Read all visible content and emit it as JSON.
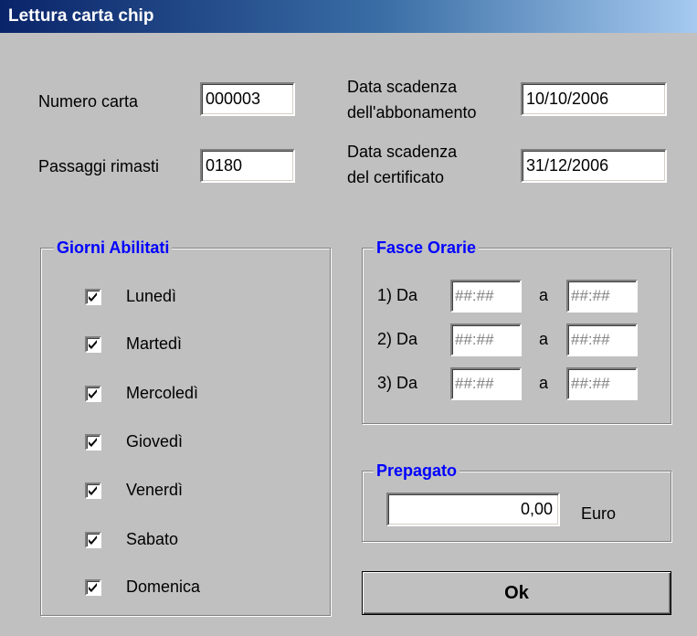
{
  "window": {
    "title": "Lettura carta chip"
  },
  "fields": {
    "numero_carta": {
      "label": "Numero carta",
      "value": "000003"
    },
    "passaggi_rimasti": {
      "label": "Passaggi rimasti",
      "value": "0180"
    },
    "scadenza_abbonamento": {
      "label_line1": "Data scadenza",
      "label_line2": "dell'abbonamento",
      "value": "10/10/2006"
    },
    "scadenza_certificato": {
      "label_line1": "Data scadenza",
      "label_line2": "del certificato",
      "value": "31/12/2006"
    }
  },
  "giorni": {
    "title": "Giorni Abilitati",
    "days": [
      {
        "label": "Lunedì",
        "checked": true
      },
      {
        "label": "Martedì",
        "checked": true
      },
      {
        "label": "Mercoledì",
        "checked": true
      },
      {
        "label": "Giovedì",
        "checked": true
      },
      {
        "label": "Venerdì",
        "checked": true
      },
      {
        "label": "Sabato",
        "checked": true
      },
      {
        "label": "Domenica",
        "checked": true
      }
    ]
  },
  "fasce": {
    "title": "Fasce Orarie",
    "rows": [
      {
        "label": "1) Da",
        "sep": "a",
        "from": "##:##",
        "to": "##:##"
      },
      {
        "label": "2) Da",
        "sep": "a",
        "from": "##:##",
        "to": "##:##"
      },
      {
        "label": "3) Da",
        "sep": "a",
        "from": "##:##",
        "to": "##:##"
      }
    ]
  },
  "prepagato": {
    "title": "Prepagato",
    "value": "0,00",
    "unit": "Euro"
  },
  "ok_button": {
    "label": "Ok"
  },
  "colors": {
    "title_bar_start": "#0a246a",
    "title_bar_end": "#a6caf0",
    "group_title": "#0000ff",
    "face": "#c0c0c0"
  }
}
